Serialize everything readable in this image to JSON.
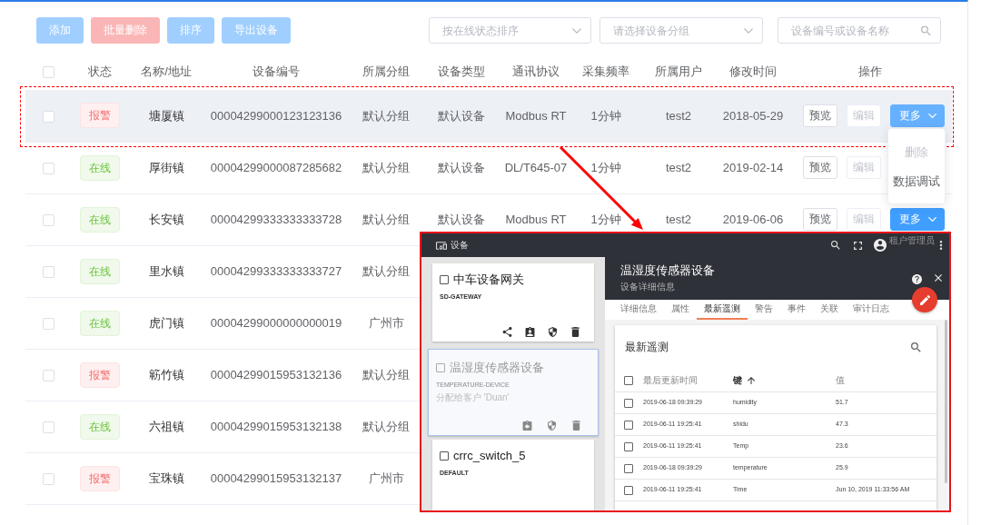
{
  "toolbar": {
    "buttons": [
      {
        "label": "添加",
        "kind": "primary",
        "disabled": true
      },
      {
        "label": "批量删除",
        "kind": "danger",
        "disabled": true
      },
      {
        "label": "排序",
        "kind": "primary",
        "disabled": true
      },
      {
        "label": "导出设备",
        "kind": "primary",
        "disabled": true
      }
    ],
    "filters": [
      {
        "placeholder": "按在线状态排序"
      },
      {
        "placeholder": "请选择设备分组"
      }
    ],
    "search": {
      "placeholder": "设备编号或设备名称"
    }
  },
  "table": {
    "select_all_checked": false,
    "columns": [
      "状态",
      "名称/地址",
      "设备编号",
      "所属分组",
      "设备类型",
      "通讯协议",
      "采集频率",
      "所属用户",
      "修改时间",
      "操作"
    ],
    "rows": [
      {
        "checked": false,
        "hovered": true,
        "status": {
          "label": "报警",
          "kind": "alarm"
        },
        "name": "塘厦镇",
        "number": "00004299000123123136",
        "group": "默认分组",
        "type": "默认设备",
        "protocol": "Modbus RT",
        "interval": "1分钟",
        "user": "test2",
        "modified": "2018-05-29",
        "actions": [
          {
            "label": "预览",
            "kind": "default",
            "disabled": false
          },
          {
            "label": "编辑",
            "kind": "default",
            "disabled": true
          },
          {
            "label": "更多",
            "kind": "primary",
            "disabled": false,
            "expanded": true,
            "menu": [
              {
                "label": "删除",
                "disabled": true
              },
              {
                "label": "数据调试",
                "disabled": false
              }
            ]
          }
        ]
      },
      {
        "checked": false,
        "hovered": false,
        "status": {
          "label": "在线",
          "kind": "online"
        },
        "name": "厚街镇",
        "number": "00004299000087285682",
        "group": "默认分组",
        "type": "默认设备",
        "protocol": "DL/T645-07",
        "interval": "1分钟",
        "user": "test2",
        "modified": "2019-02-14",
        "actions": [
          {
            "label": "预览",
            "kind": "default",
            "disabled": false
          },
          {
            "label": "编辑",
            "kind": "default",
            "disabled": true
          }
        ]
      },
      {
        "checked": false,
        "hovered": false,
        "status": {
          "label": "在线",
          "kind": "online"
        },
        "name": "长安镇",
        "number": "00004299333333333728",
        "group": "默认分组",
        "type": "默认设备",
        "protocol": "Modbus RT",
        "interval": "1分钟",
        "user": "test2",
        "modified": "2019-06-06",
        "actions": [
          {
            "label": "预览",
            "kind": "default",
            "disabled": false
          },
          {
            "label": "编辑",
            "kind": "default",
            "disabled": true
          },
          {
            "label": "更多",
            "kind": "primary",
            "disabled": false,
            "expanded": false
          }
        ]
      },
      {
        "checked": false,
        "hovered": false,
        "status": {
          "label": "在线",
          "kind": "online"
        },
        "name": "里水镇",
        "number": "00004299333333333727",
        "group": "默认分组"
      },
      {
        "checked": false,
        "hovered": false,
        "status": {
          "label": "在线",
          "kind": "online"
        },
        "name": "虎门镇",
        "number": "00004299000000000019",
        "group": "广州市"
      },
      {
        "checked": false,
        "hovered": false,
        "status": {
          "label": "报警",
          "kind": "alarm"
        },
        "name": "簕竹镇",
        "number": "00004299015953132136",
        "group": "默认分组"
      },
      {
        "checked": false,
        "hovered": false,
        "status": {
          "label": "在线",
          "kind": "online"
        },
        "name": "六祖镇",
        "number": "00004299015953132138",
        "group": "默认分组"
      },
      {
        "checked": false,
        "hovered": false,
        "status": {
          "label": "报警",
          "kind": "alarm"
        },
        "name": "宝珠镇",
        "number": "00004299015953132137",
        "group": "广州市"
      }
    ]
  },
  "inset": {
    "top_bar": {
      "title": "设备",
      "user_role": "租户管理员"
    },
    "device_cards": [
      {
        "name": "中车设备网关",
        "type": "SD-GATEWAY",
        "checked": false,
        "selected": false,
        "actions": [
          {
            "kind": "share"
          },
          {
            "kind": "assign"
          },
          {
            "kind": "credentials"
          },
          {
            "kind": "delete"
          }
        ]
      },
      {
        "name": "温湿度传感器设备",
        "type": "TEMPERATURE-DEVICE",
        "customer": "分配给客户 'Duan'",
        "checked": false,
        "selected": true,
        "actions": [
          {
            "kind": "unassign"
          },
          {
            "kind": "credentials"
          },
          {
            "kind": "delete"
          }
        ]
      },
      {
        "name": "crrc_switch_5",
        "type": "DEFAULT",
        "checked": false,
        "selected": false
      }
    ],
    "detail": {
      "title": "温湿度传感器设备",
      "subtitle": "设备详细信息",
      "tabs": [
        {
          "label": "详细信息",
          "selected": false
        },
        {
          "label": "属性",
          "selected": false
        },
        {
          "label": "最新遥测",
          "selected": true
        },
        {
          "label": "警告",
          "selected": false
        },
        {
          "label": "事件",
          "selected": false
        },
        {
          "label": "关联",
          "selected": false
        },
        {
          "label": "审计日志",
          "selected": false
        }
      ],
      "telemetry": {
        "title": "最新遥测",
        "select_all_checked": false,
        "columns": [
          {
            "label": "最后更新时间",
            "sorted": false
          },
          {
            "label": "键",
            "sorted": true
          },
          {
            "label": "值",
            "sorted": false
          }
        ],
        "rows": [
          {
            "checked": false,
            "time": "2019-06-18 09:39:29",
            "key": "humidity",
            "value": "51.7"
          },
          {
            "checked": false,
            "time": "2019-06-11 19:25:41",
            "key": "shidu",
            "value": "47.3"
          },
          {
            "checked": false,
            "time": "2019-06-11 19:25:41",
            "key": "Temp",
            "value": "23.6"
          },
          {
            "checked": false,
            "time": "2019-06-18 09:39:29",
            "key": "temperature",
            "value": "25.9"
          },
          {
            "checked": false,
            "time": "2019-06-11 19:25:41",
            "key": "Time",
            "value": "Jun 10, 2019 11:33:56 AM"
          }
        ]
      }
    }
  }
}
